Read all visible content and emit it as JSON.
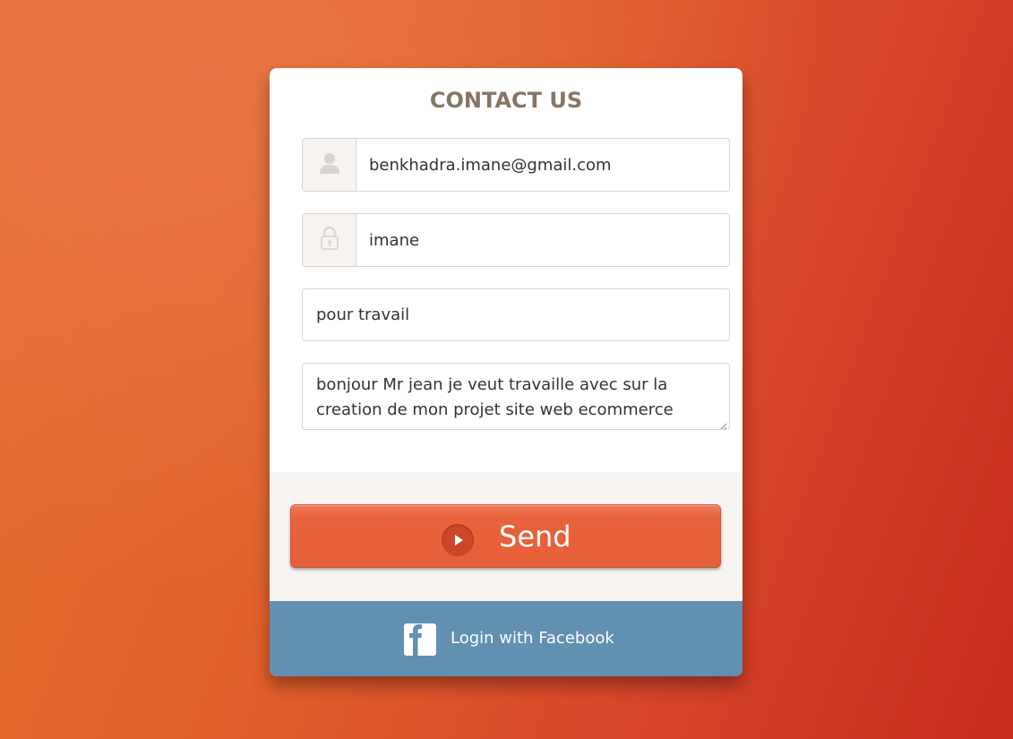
{
  "form": {
    "title": "CONTACT US",
    "email_value": "benkhadra.imane@gmail.com",
    "password_value": "imane",
    "subject_value": "pour travail",
    "message_value": "bonjour Mr jean je veut travaille avec sur la creation de mon projet site web ecommerce",
    "send_label": "Send",
    "facebook_label": "Login with Facebook"
  },
  "icons": {
    "email": "user-icon",
    "password": "lock-icon",
    "send": "play-icon",
    "facebook": "facebook-icon"
  },
  "colors": {
    "title": "#857565",
    "send_button": "#e8623c",
    "facebook_bar": "#6190b1",
    "send_area_bg": "#f7f3f1"
  }
}
